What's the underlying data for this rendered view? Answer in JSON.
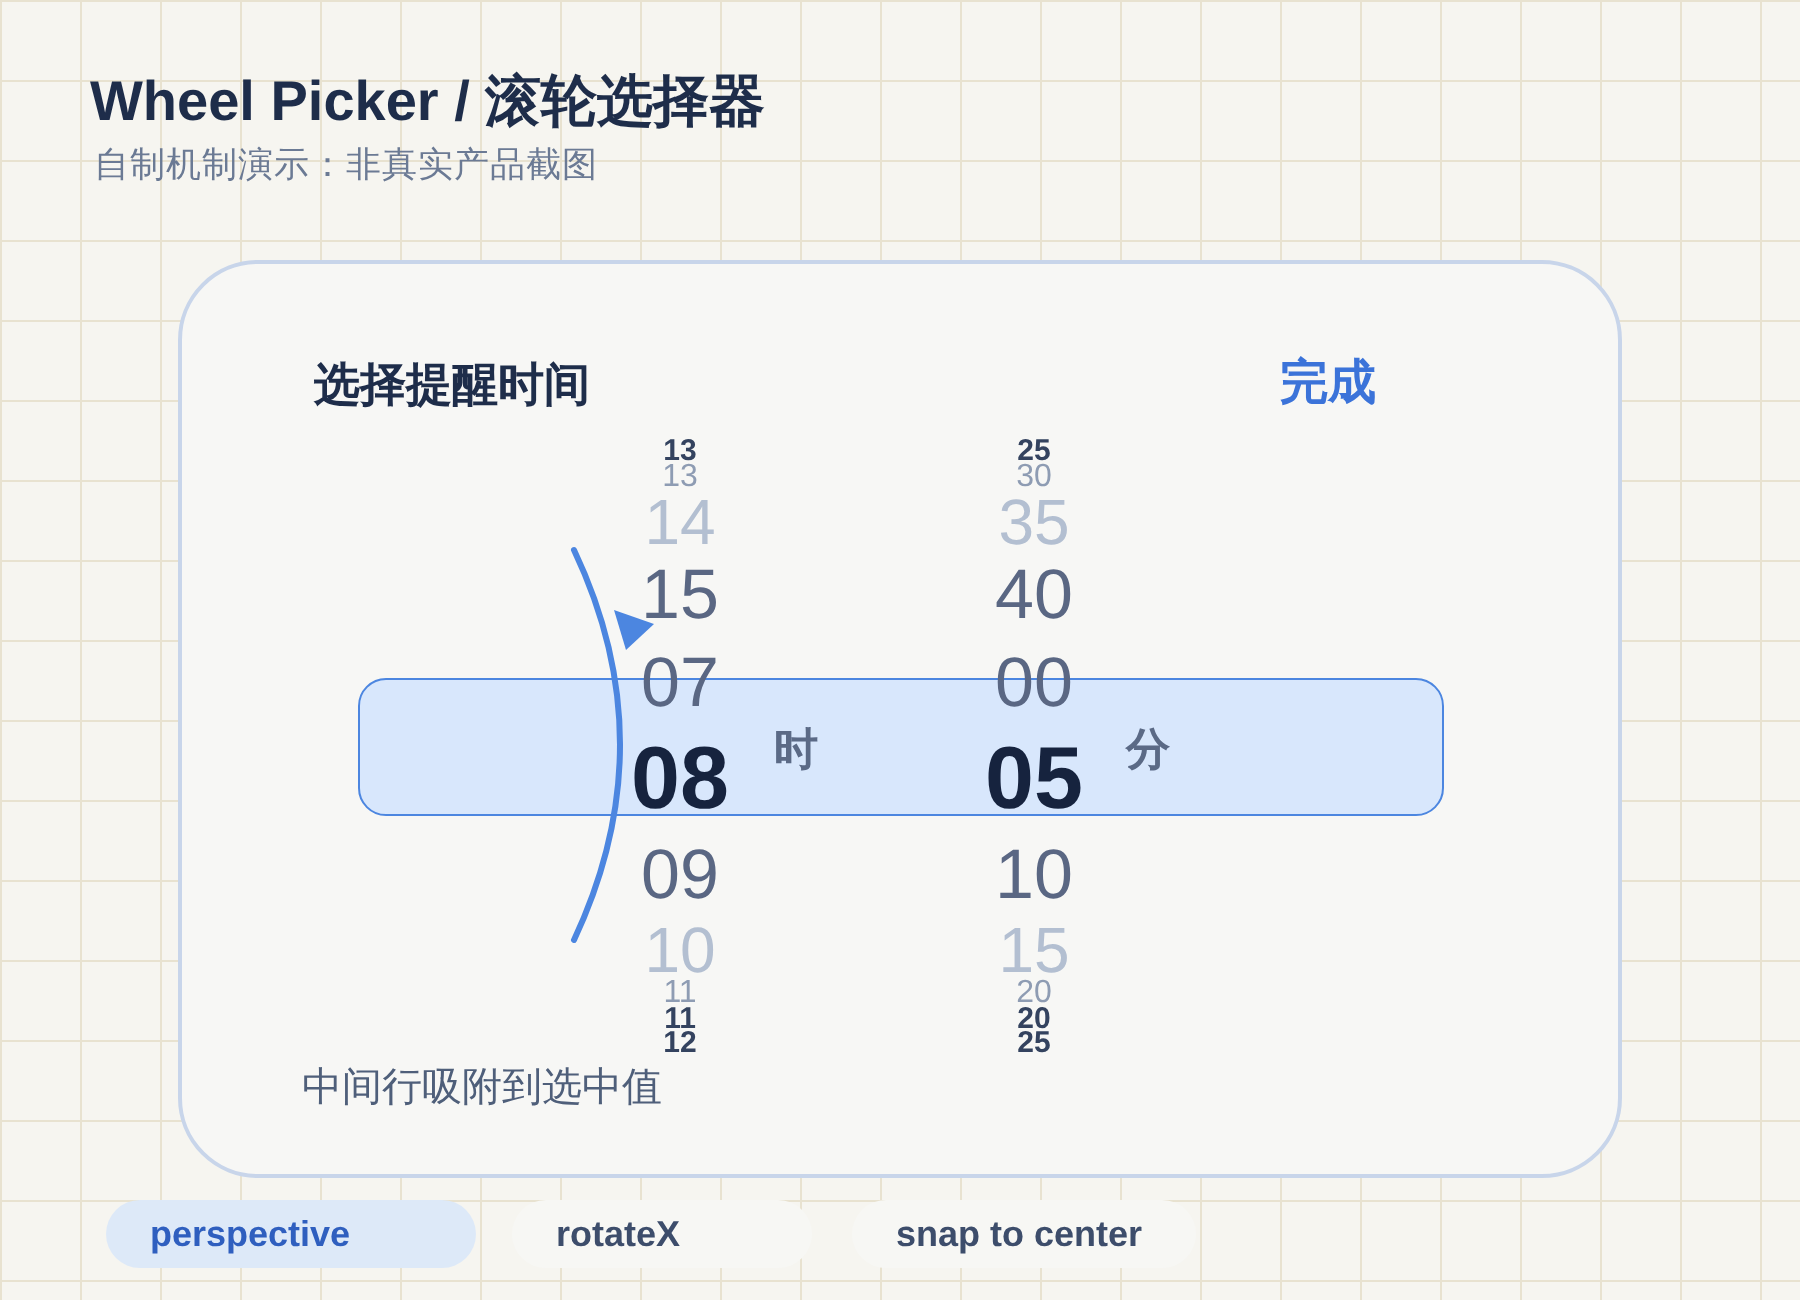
{
  "page": {
    "title": "Wheel Picker / 滚轮选择器",
    "subtitle": "自制机制演示：非真实产品截图"
  },
  "picker": {
    "title": "选择提醒时间",
    "done_button": "完成",
    "columns": [
      {
        "unit": "时",
        "items": [
          {
            "label": "13",
            "kind": "back",
            "selected": false
          },
          {
            "label": "13",
            "kind": "edge",
            "selected": false
          },
          {
            "label": "14",
            "kind": "far",
            "selected": false
          },
          {
            "label": "15",
            "kind": "near",
            "selected": false
          },
          {
            "label": "07",
            "kind": "near",
            "selected": false
          },
          {
            "label": "08",
            "kind": "center",
            "selected": true
          },
          {
            "label": "09",
            "kind": "near",
            "selected": false
          },
          {
            "label": "10",
            "kind": "far",
            "selected": false
          },
          {
            "label": "11",
            "kind": "edge",
            "selected": false
          },
          {
            "label": "11",
            "kind": "back",
            "selected": false
          },
          {
            "label": "12",
            "kind": "back",
            "selected": false
          }
        ]
      },
      {
        "unit": "分",
        "items": [
          {
            "label": "25",
            "kind": "back",
            "selected": false
          },
          {
            "label": "30",
            "kind": "edge",
            "selected": false
          },
          {
            "label": "35",
            "kind": "far",
            "selected": false
          },
          {
            "label": "40",
            "kind": "near",
            "selected": false
          },
          {
            "label": "00",
            "kind": "near",
            "selected": false
          },
          {
            "label": "05",
            "kind": "center",
            "selected": true
          },
          {
            "label": "10",
            "kind": "near",
            "selected": false
          },
          {
            "label": "15",
            "kind": "far",
            "selected": false
          },
          {
            "label": "20",
            "kind": "edge",
            "selected": false
          },
          {
            "label": "20",
            "kind": "back",
            "selected": false
          },
          {
            "label": "25",
            "kind": "back",
            "selected": false
          }
        ]
      }
    ],
    "caption": "中间行吸附到选中值"
  },
  "modes": [
    {
      "label": "perspective",
      "selected": true
    },
    {
      "label": "rotateX",
      "selected": false
    },
    {
      "label": "snap to center",
      "selected": false
    }
  ]
}
